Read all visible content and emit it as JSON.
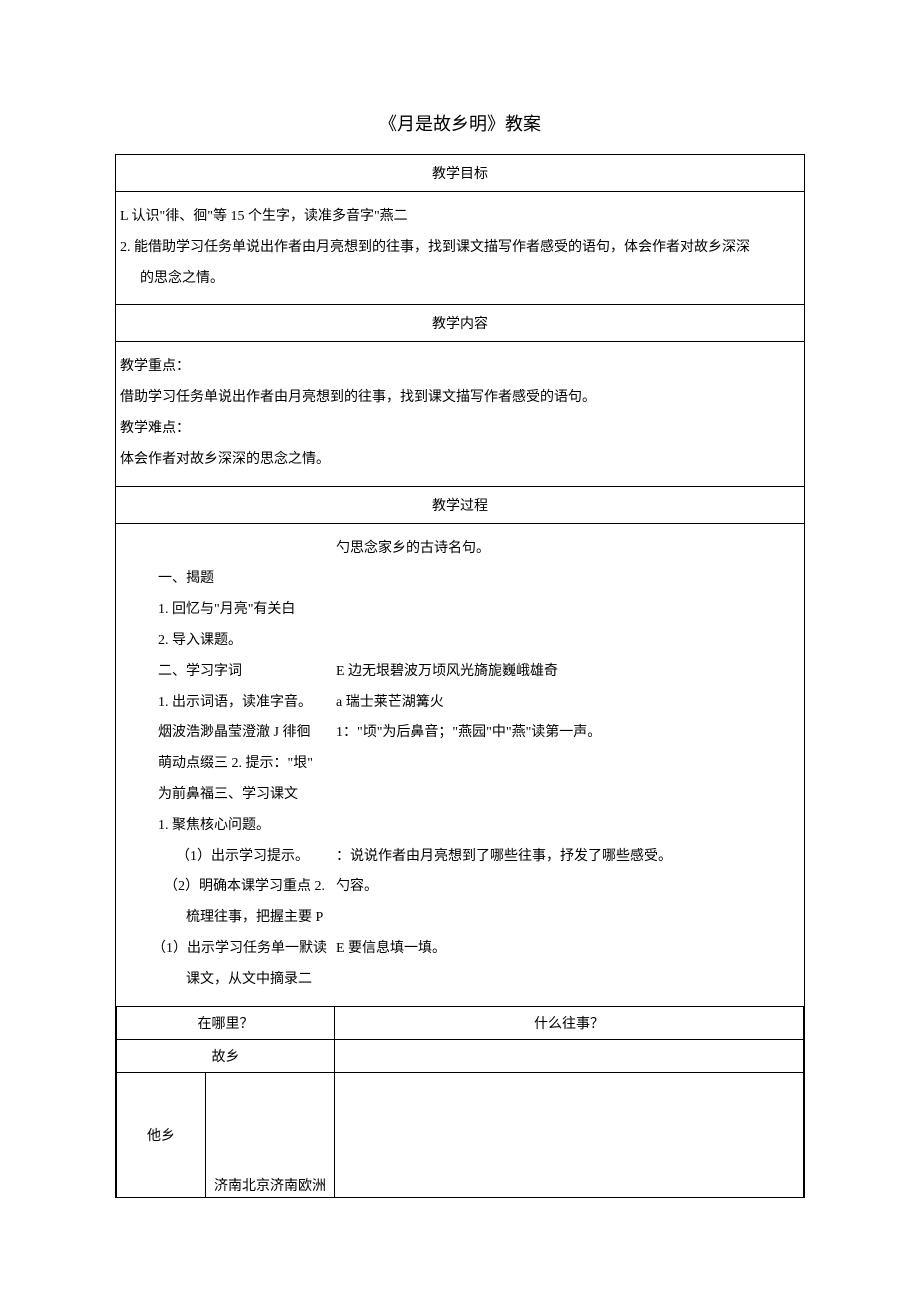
{
  "title": "《月是故乡明》教案",
  "sections": {
    "goals_header": "教学目标",
    "goals_line1": "L 认识\"徘、徊\"等 15 个生字，读准多音字\"燕二",
    "goals_line2": "2. 能借助学习任务单说出作者由月亮想到的往事，找到课文描写作者感受的语句，体会作者对故乡深深",
    "goals_line2b": "的思念之情。",
    "content_header": "教学内容",
    "focus_label": "教学重点：",
    "focus_text": "借助学习任务单说出作者由月亮想到的往事，找到课文描写作者感受的语句。",
    "difficulty_label": "教学难点：",
    "difficulty_text": "体会作者对故乡深深的思念之情。",
    "process_header": "教学过程"
  },
  "process": {
    "left": {
      "l1": "一、揭题",
      "l2": "1. 回忆与\"月亮\"有关白",
      "l3": "2. 导入课题。",
      "l4": "二、学习字词",
      "l5": "1. 出示词语，读准字音。",
      "l6": "烟波浩渺晶莹澄澈 J 徘徊",
      "l7": "萌动点缀三 2. 提示：\"垠\"",
      "l8": "为前鼻福三、学习课文",
      "l9": "1. 聚焦核心问题。",
      "l10": "（1）出示学习提示。",
      "l11": "（2）明确本课学习重点 2.",
      "l12": "梳理往事，把握主要 P",
      "l13": "（1）出示学习任务单一默读",
      "l14": "课文，从文中摘录二"
    },
    "right": {
      "r1": "勺思念家乡的古诗名句。",
      "r2": "E 边无垠碧波万顷风光旖旎巍峨雄奇",
      "r3": "a 瑞士莱芒湖篝火",
      "r4": "1：\"顷\"为后鼻音；\"燕园\"中\"燕\"读第一声。",
      "r5": "：说说作者由月亮想到了哪些往事，抒发了哪些感受。",
      "r6": "勺容。",
      "r7": "E 要信息填一填。"
    }
  },
  "inner_table": {
    "h1": "在哪里？",
    "h2": "什么往事？",
    "r1c1": "故乡",
    "r2c1": "他乡",
    "r2c2": "济南北京济南欧洲"
  }
}
